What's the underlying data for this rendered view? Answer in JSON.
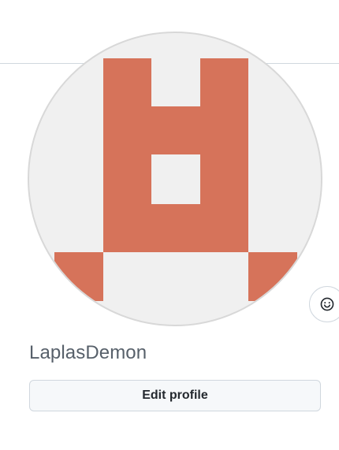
{
  "profile": {
    "avatar_fill_color": "#d6735a",
    "avatar_background_color": "#f0f0f0",
    "status_icon": "smiley-icon",
    "username": "LaplasDemon",
    "edit_profile_label": "Edit profile"
  }
}
